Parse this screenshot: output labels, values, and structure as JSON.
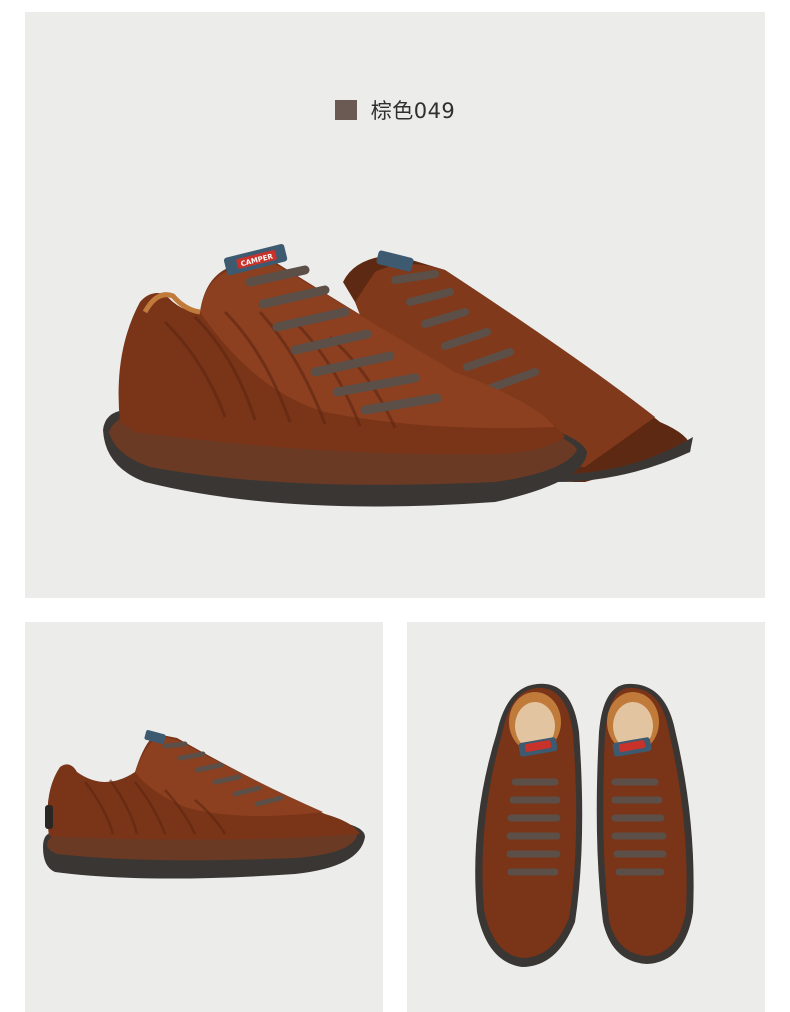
{
  "color_option": {
    "label": "棕色049",
    "swatch_color": "#6b5a53"
  },
  "brand_tag": "CAMPER",
  "colors": {
    "panel_bg": "#ececeb",
    "leather": "#7a3418",
    "leather_light": "#9a4b28",
    "laces": "#5c4f48",
    "sole": "#3a3634",
    "sole_rim": "#6b3a24",
    "tag_blue": "#3d5a70",
    "tag_red": "#c8322a"
  },
  "images": [
    {
      "name": "pair-three-quarter-view",
      "icon": "shoe-pair"
    },
    {
      "name": "side-profile-view",
      "icon": "shoe-side"
    },
    {
      "name": "top-down-view",
      "icon": "shoe-top"
    }
  ]
}
